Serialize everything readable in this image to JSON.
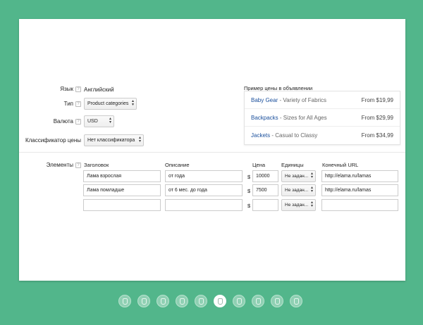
{
  "form": {
    "language_label": "Язык",
    "language_value": "Английский",
    "type_label": "Тип",
    "type_value": "Product categories",
    "currency_label": "Валюта",
    "currency_value": "USD",
    "qualifier_label": "Классификатор цены",
    "qualifier_value": "Нет классификатора",
    "help_glyph": "?"
  },
  "sample": {
    "title": "Пример цены в объявлении",
    "rows": [
      {
        "name": "Baby Gear",
        "desc": " - Variety of Fabrics",
        "price": "From $19,99"
      },
      {
        "name": "Backpacks",
        "desc": " - Sizes for All Ages",
        "price": "From $29,99"
      },
      {
        "name": "Jackets",
        "desc": " - Casual to Classy",
        "price": "From $34,99"
      }
    ]
  },
  "items": {
    "label": "Элементы",
    "headers": {
      "title": "Заголовок",
      "description": "Описание",
      "price": "Цена",
      "units": "Единицы",
      "url": "Конечный URL"
    },
    "currency_symbol": "$",
    "rows": [
      {
        "title": "Лама взрослая",
        "description": "от года",
        "price": "10000",
        "units": "Не задан...",
        "url": "http://elama.ru/lamas"
      },
      {
        "title": "Лама помладше",
        "description": "от 6 мес. до года",
        "price": "7500",
        "units": "Не задан...",
        "url": "http://elama.ru/lamas"
      },
      {
        "title": "",
        "description": "",
        "price": "",
        "units": "Не задан...",
        "url": ""
      }
    ]
  },
  "pagination": {
    "total": 10,
    "active_index": 5
  }
}
